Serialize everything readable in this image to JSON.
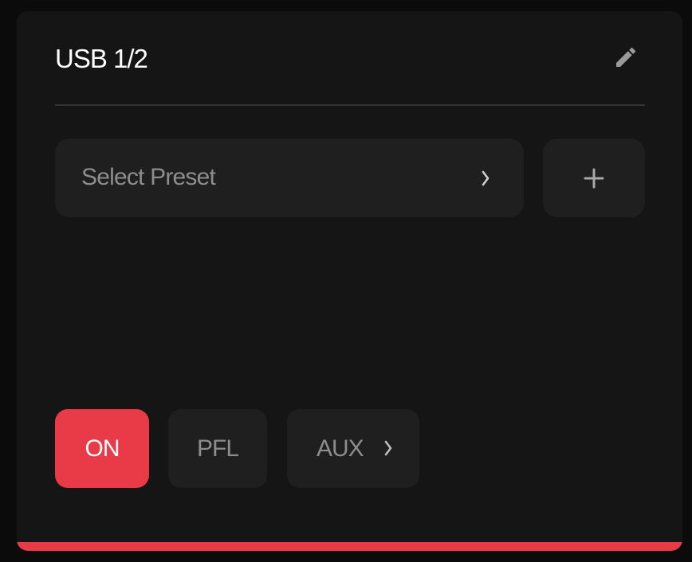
{
  "channel": {
    "title": "USB 1/2"
  },
  "preset": {
    "label": "Select Preset",
    "add_label": "+"
  },
  "buttons": {
    "on_label": "ON",
    "pfl_label": "PFL",
    "aux_label": "AUX"
  },
  "icons": {
    "edit": "pencil-icon",
    "preset_chevron": "chevron-right-icon",
    "add": "plus-icon",
    "aux_chevron": "chevron-right-icon"
  },
  "colors": {
    "accent": "#e93a48",
    "card_background": "#151515",
    "control_background": "#1f1f1f",
    "muted_text": "#8d8d8d",
    "primary_text": "#ffffff"
  },
  "state": {
    "on_active": true,
    "pfl_active": false
  }
}
